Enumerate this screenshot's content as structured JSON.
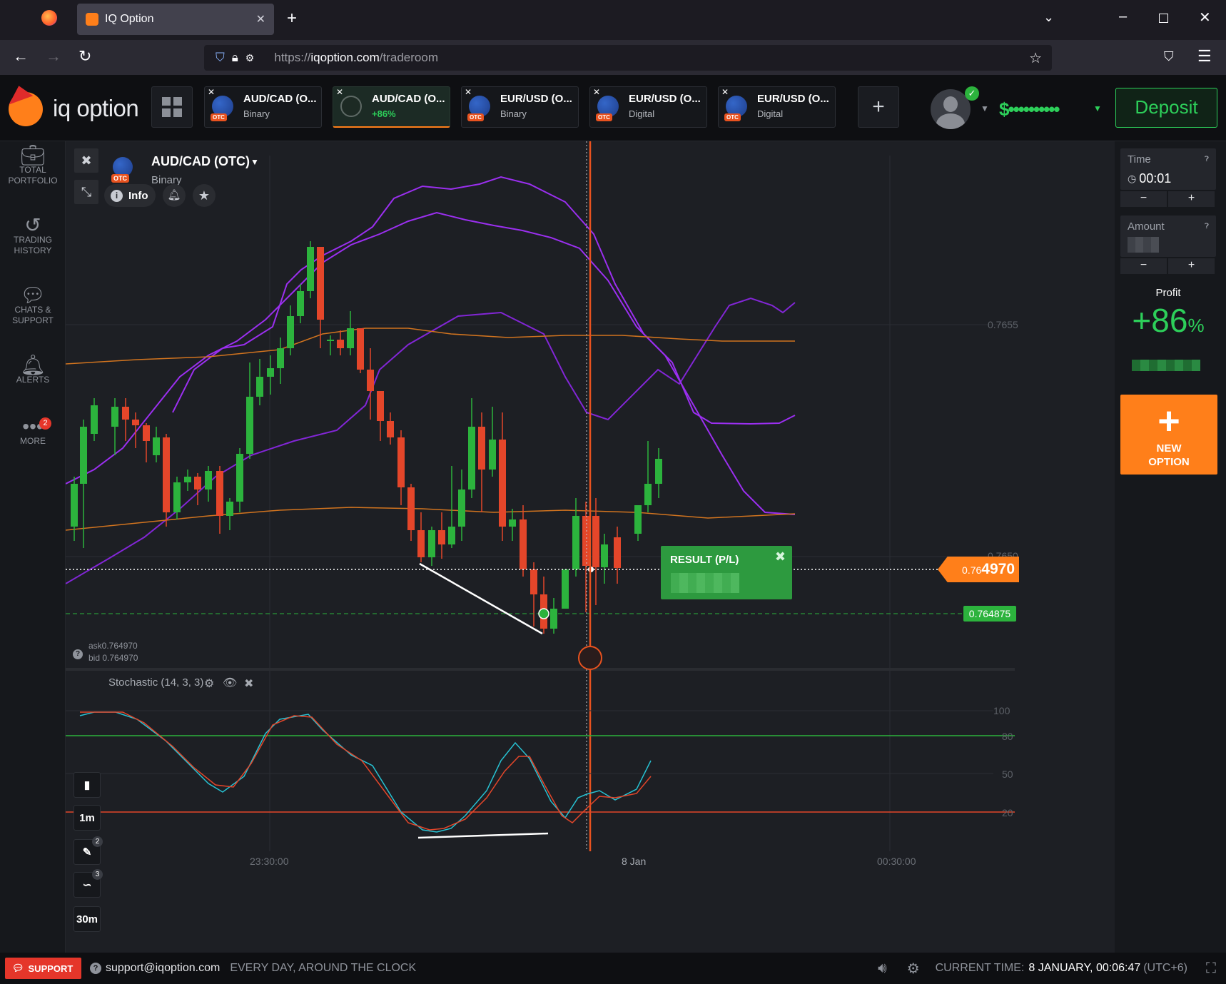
{
  "browser": {
    "tab_title": "IQ Option",
    "url_prefix": "https://",
    "url_host": "iqoption.com",
    "url_path": "/traderoom"
  },
  "header": {
    "logo": "iq option",
    "tabs": [
      {
        "name": "AUD/CAD (O...",
        "type": "Binary"
      },
      {
        "name": "AUD/CAD (O...",
        "type": "+86%"
      },
      {
        "name": "EUR/USD (O...",
        "type": "Binary"
      },
      {
        "name": "EUR/USD (O...",
        "type": "Digital"
      },
      {
        "name": "EUR/USD (O...",
        "type": "Digital"
      }
    ],
    "balance": "$••••••••••",
    "deposit": "Deposit"
  },
  "sidebar": [
    {
      "label": "TOTAL PORTFOLIO",
      "icon": "briefcase-icon"
    },
    {
      "label": "TRADING HISTORY",
      "icon": "history-icon"
    },
    {
      "label": "CHATS & SUPPORT",
      "icon": "chat-icon"
    },
    {
      "label": "ALERTS",
      "icon": "bell-icon"
    },
    {
      "label": "MORE",
      "icon": "more-icon",
      "badge": "2"
    }
  ],
  "asset": {
    "name": "AUD/CAD (OTC)",
    "type": "Binary",
    "info": "Info",
    "otc": "OTC"
  },
  "chart": {
    "price_levels": [
      "0.7655",
      "0.7650"
    ],
    "current_price_prefix": "0.76",
    "current_price_main": "4970",
    "strike_price": "0.764875",
    "ask": "ask0.764970",
    "bid": "bid 0.764970",
    "x_labels": [
      "23:30:00",
      "8 Jan",
      "00:30:00"
    ],
    "result_title": "RESULT (P/L)"
  },
  "indicator": {
    "name": "Stochastic (14, 3, 3)",
    "levels": [
      "100",
      "80",
      "50",
      "20"
    ]
  },
  "tools": {
    "timeframe": "1m",
    "draw_badge": "2",
    "indicator_badge": "3",
    "candle_period": "30m"
  },
  "panel": {
    "time_label": "Time",
    "time_value": "00:01",
    "amount_label": "Amount",
    "profit_label": "Profit",
    "profit_value": "+86",
    "profit_unit": "%",
    "new_option": "NEW OPTION",
    "minus": "−",
    "plus": "+"
  },
  "footer": {
    "support": "SUPPORT",
    "email": "support@iqoption.com",
    "hours": "EVERY DAY, AROUND THE CLOCK",
    "time_label": "CURRENT TIME:",
    "time_value": "8 JANUARY, 00:06:47",
    "tz": "(UTC+6)"
  },
  "colors": {
    "up": "#2cb33d",
    "down": "#e4462a",
    "accent": "#ff7f1a",
    "bollinger": "#9b2ff0",
    "ma": "#d2741f",
    "k_line": "#27c2d3",
    "d_line": "#e4462a"
  }
}
